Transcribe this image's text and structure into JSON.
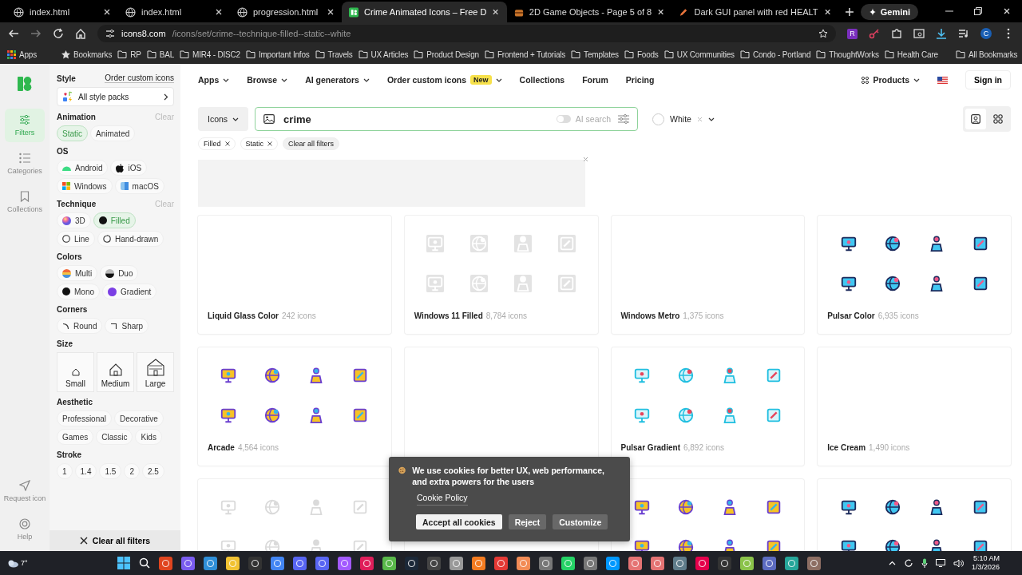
{
  "browser": {
    "tabs": [
      {
        "title": "index.html",
        "kind": "globe",
        "selected": false
      },
      {
        "title": "index.html",
        "kind": "globe",
        "selected": false
      },
      {
        "title": "progression.html",
        "kind": "globe",
        "selected": false
      },
      {
        "title": "Crime Animated Icons – Free D",
        "kind": "site",
        "selected": true
      },
      {
        "title": "2D Game Objects - Page 5 of 8",
        "kind": "chest",
        "selected": false
      },
      {
        "title": "Dark GUI panel with red HEALT",
        "kind": "pencil",
        "selected": false
      }
    ],
    "gemini": "Gemini",
    "address": {
      "domain": "icons8.com",
      "path": "/icons/set/crime--technique-filled--static--white"
    },
    "extension_letter": "R",
    "profile_initial": "C",
    "bookmarks": [
      {
        "label": "Apps",
        "kind": "apps"
      },
      {
        "label": "Bookmarks",
        "kind": "star"
      },
      {
        "label": "RP",
        "kind": "folder"
      },
      {
        "label": "BAL",
        "kind": "folder"
      },
      {
        "label": "MIR4 - DISC2",
        "kind": "folder"
      },
      {
        "label": "Important Infos",
        "kind": "folder"
      },
      {
        "label": "Travels",
        "kind": "folder"
      },
      {
        "label": "UX Articles",
        "kind": "folder"
      },
      {
        "label": "Product Design",
        "kind": "folder"
      },
      {
        "label": "Frontend + Tutorials",
        "kind": "folder"
      },
      {
        "label": "Templates",
        "kind": "folder"
      },
      {
        "label": "Foods",
        "kind": "folder"
      },
      {
        "label": "UX Communities",
        "kind": "folder"
      },
      {
        "label": "Condo - Portland",
        "kind": "folder"
      },
      {
        "label": "ThoughtWorks",
        "kind": "folder"
      },
      {
        "label": "Health Care",
        "kind": "folder"
      }
    ],
    "all_bookmarks": "All Bookmarks"
  },
  "rail": {
    "top": [
      {
        "label": "Filters",
        "kind": "filters",
        "selected": true
      },
      {
        "label": "Categories",
        "kind": "categories",
        "selected": false
      },
      {
        "label": "Collections",
        "kind": "collections",
        "selected": false
      }
    ],
    "bottom": [
      {
        "label": "Request icon",
        "kind": "request",
        "selected": false
      },
      {
        "label": "Help",
        "kind": "help",
        "selected": false
      }
    ]
  },
  "filters": {
    "title": "Style",
    "order_link": "Order custom icons",
    "style_packs": "All style packs",
    "sections": [
      {
        "title": "Animation",
        "kind": "chips",
        "clear": "Clear",
        "options": [
          {
            "label": "Static",
            "selected": true
          },
          {
            "label": "Animated",
            "selected": false
          }
        ]
      },
      {
        "title": "OS",
        "kind": "chips",
        "options": [
          {
            "label": "Android",
            "kind": "android",
            "selected": false
          },
          {
            "label": "iOS",
            "kind": "apple",
            "selected": false
          },
          {
            "label": "Windows",
            "kind": "windows",
            "selected": false
          },
          {
            "label": "macOS",
            "kind": "finder",
            "selected": false
          }
        ]
      },
      {
        "title": "Technique",
        "kind": "chips",
        "clear": "Clear",
        "options": [
          {
            "label": "3D",
            "kind": "sphere",
            "selected": false
          },
          {
            "label": "Filled",
            "kind": "dot",
            "selected": true
          },
          {
            "label": "Line",
            "kind": "ring",
            "selected": false
          },
          {
            "label": "Hand-drawn",
            "kind": "sketch",
            "selected": false
          }
        ]
      },
      {
        "title": "Colors",
        "kind": "chips",
        "options": [
          {
            "label": "Multi",
            "kind": "multi",
            "selected": false
          },
          {
            "label": "Duo",
            "kind": "duo",
            "selected": false
          },
          {
            "label": "Mono",
            "kind": "dot",
            "selected": false
          },
          {
            "label": "Gradient",
            "kind": "purple",
            "selected": false
          }
        ]
      },
      {
        "title": "Corners",
        "kind": "chips",
        "options": [
          {
            "label": "Round",
            "kind": "round",
            "selected": false
          },
          {
            "label": "Sharp",
            "kind": "sharp",
            "selected": false
          }
        ]
      },
      {
        "title": "Size",
        "kind": "tiles",
        "options": [
          {
            "label": "Small",
            "selected": false
          },
          {
            "label": "Medium",
            "selected": false
          },
          {
            "label": "Large",
            "selected": false
          }
        ]
      },
      {
        "title": "Aesthetic",
        "kind": "chips",
        "options": [
          {
            "label": "Professional",
            "selected": false
          },
          {
            "label": "Decorative",
            "selected": false
          },
          {
            "label": "Games",
            "selected": false
          },
          {
            "label": "Classic",
            "selected": false
          },
          {
            "label": "Kids",
            "selected": false
          }
        ]
      },
      {
        "title": "Stroke",
        "kind": "chips",
        "options": [
          {
            "label": "1",
            "selected": false
          },
          {
            "label": "1.4",
            "selected": false
          },
          {
            "label": "1.5",
            "selected": false
          },
          {
            "label": "2",
            "selected": false
          },
          {
            "label": "2.5",
            "selected": false
          }
        ]
      }
    ],
    "clear_all": "Clear all filters"
  },
  "nav": {
    "items": [
      {
        "label": "Apps",
        "dropdown": true
      },
      {
        "label": "Browse",
        "dropdown": true
      },
      {
        "label": "AI generators",
        "dropdown": true
      },
      {
        "label": "Order custom icons",
        "dropdown": true,
        "badge": "New"
      },
      {
        "label": "Collections",
        "dropdown": false
      },
      {
        "label": "Forum",
        "dropdown": false
      },
      {
        "label": "Pricing",
        "dropdown": false
      }
    ],
    "products": "Products",
    "sign_in": "Sign in"
  },
  "search": {
    "type": "Icons",
    "value": "crime",
    "ai_search": {
      "label": "AI search",
      "on": false
    },
    "color_filter": "White",
    "view_toggles": [
      {
        "kind": "single",
        "selected": true
      },
      {
        "kind": "grid",
        "selected": false
      }
    ]
  },
  "active_filters": [
    "Filled",
    "Static"
  ],
  "clear_filters": "Clear all filters",
  "cards": [
    {
      "name": "Liquid Glass Color",
      "count": "242 icons",
      "kind": "loading"
    },
    {
      "name": "Windows 11 Filled",
      "count": "8,784 icons",
      "kind": "gray"
    },
    {
      "name": "Windows Metro",
      "count": "1,375 icons",
      "kind": "loading"
    },
    {
      "name": "Pulsar Color",
      "count": "6,935 icons",
      "kind": "pulsar"
    },
    {
      "name": "Arcade",
      "count": "4,564 icons",
      "kind": "arcade"
    },
    {
      "kind": "loading"
    },
    {
      "name": "Pulsar Gradient",
      "count": "6,892 icons",
      "kind": "gradient"
    },
    {
      "name": "Ice Cream",
      "count": "1,490 icons",
      "kind": "loading"
    },
    {
      "kind": "faded"
    },
    {
      "kind": "loading"
    },
    {
      "kind": "arcade"
    },
    {
      "kind": "pulsar"
    }
  ],
  "cookie": {
    "message": "We use cookies for better UX, web performance, and extra powers for the users",
    "policy": "Cookie Policy",
    "buttons": [
      {
        "label": "Accept all cookies",
        "kind": "primary"
      },
      {
        "label": "Reject",
        "kind": "secondary"
      },
      {
        "label": "Customize",
        "kind": "secondary"
      }
    ]
  },
  "taskbar": {
    "weather": "7°",
    "time": "5:10 AM",
    "date": "1/3/2026"
  }
}
